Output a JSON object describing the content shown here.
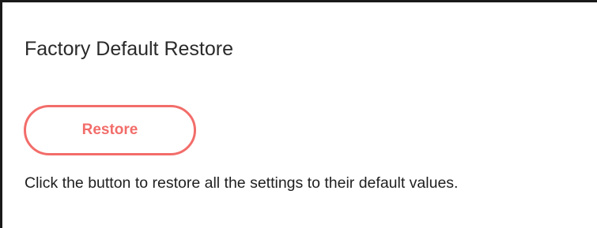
{
  "section": {
    "title": "Factory Default Restore",
    "restore_button_label": "Restore",
    "description": "Click the button to restore all the settings to their default values."
  },
  "colors": {
    "accent": "#f26d6a",
    "text": "#2a2a2a",
    "border": "#1a1a1a"
  }
}
